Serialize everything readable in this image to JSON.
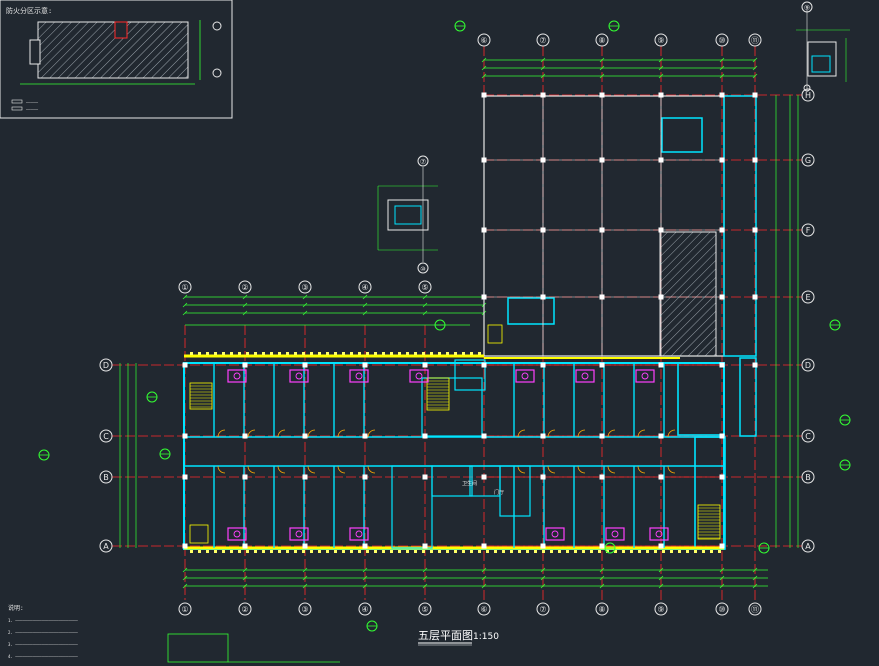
{
  "drawing": {
    "title": "五层平面图",
    "scale": "1:150",
    "keyplan_label": "防火分区示意:",
    "keyplan_legend": [
      "—————",
      "—————"
    ],
    "notes_heading": "说明:",
    "notes_lines": [
      "1. ——————————————————————————",
      "2. ——————————————————————————",
      "3. ——————————————————————————",
      "4. ——————————————————————————"
    ],
    "room_tag": "卫生间",
    "corridor_tag": "门厅"
  },
  "grid": {
    "bottom_axes": [
      "①",
      "②",
      "③",
      "④",
      "⑤",
      "⑥",
      "⑦",
      "⑧",
      "⑨",
      "⑩",
      "⑪"
    ],
    "top_axes": [
      "⑥",
      "⑦",
      "⑧",
      "⑨",
      "⑩",
      "⑪"
    ],
    "left_axes": [
      "D",
      "C",
      "B",
      "A"
    ],
    "right_axes": [
      "H",
      "G",
      "F",
      "E",
      "D",
      "C",
      "B",
      "A"
    ],
    "detail_axis_top": "⑨",
    "detail_axis_mid_top": "⑦",
    "detail_axis_mid_bottom": "⑩"
  },
  "colors": {
    "background": "#212830",
    "wall": "#00e5ff",
    "grid_line": "#ff2a2a",
    "dimension": "#33ff33",
    "column": "#ffffff",
    "stair": "#ffff00",
    "fixture": "#ff40ff",
    "door": "#ffaa00"
  }
}
